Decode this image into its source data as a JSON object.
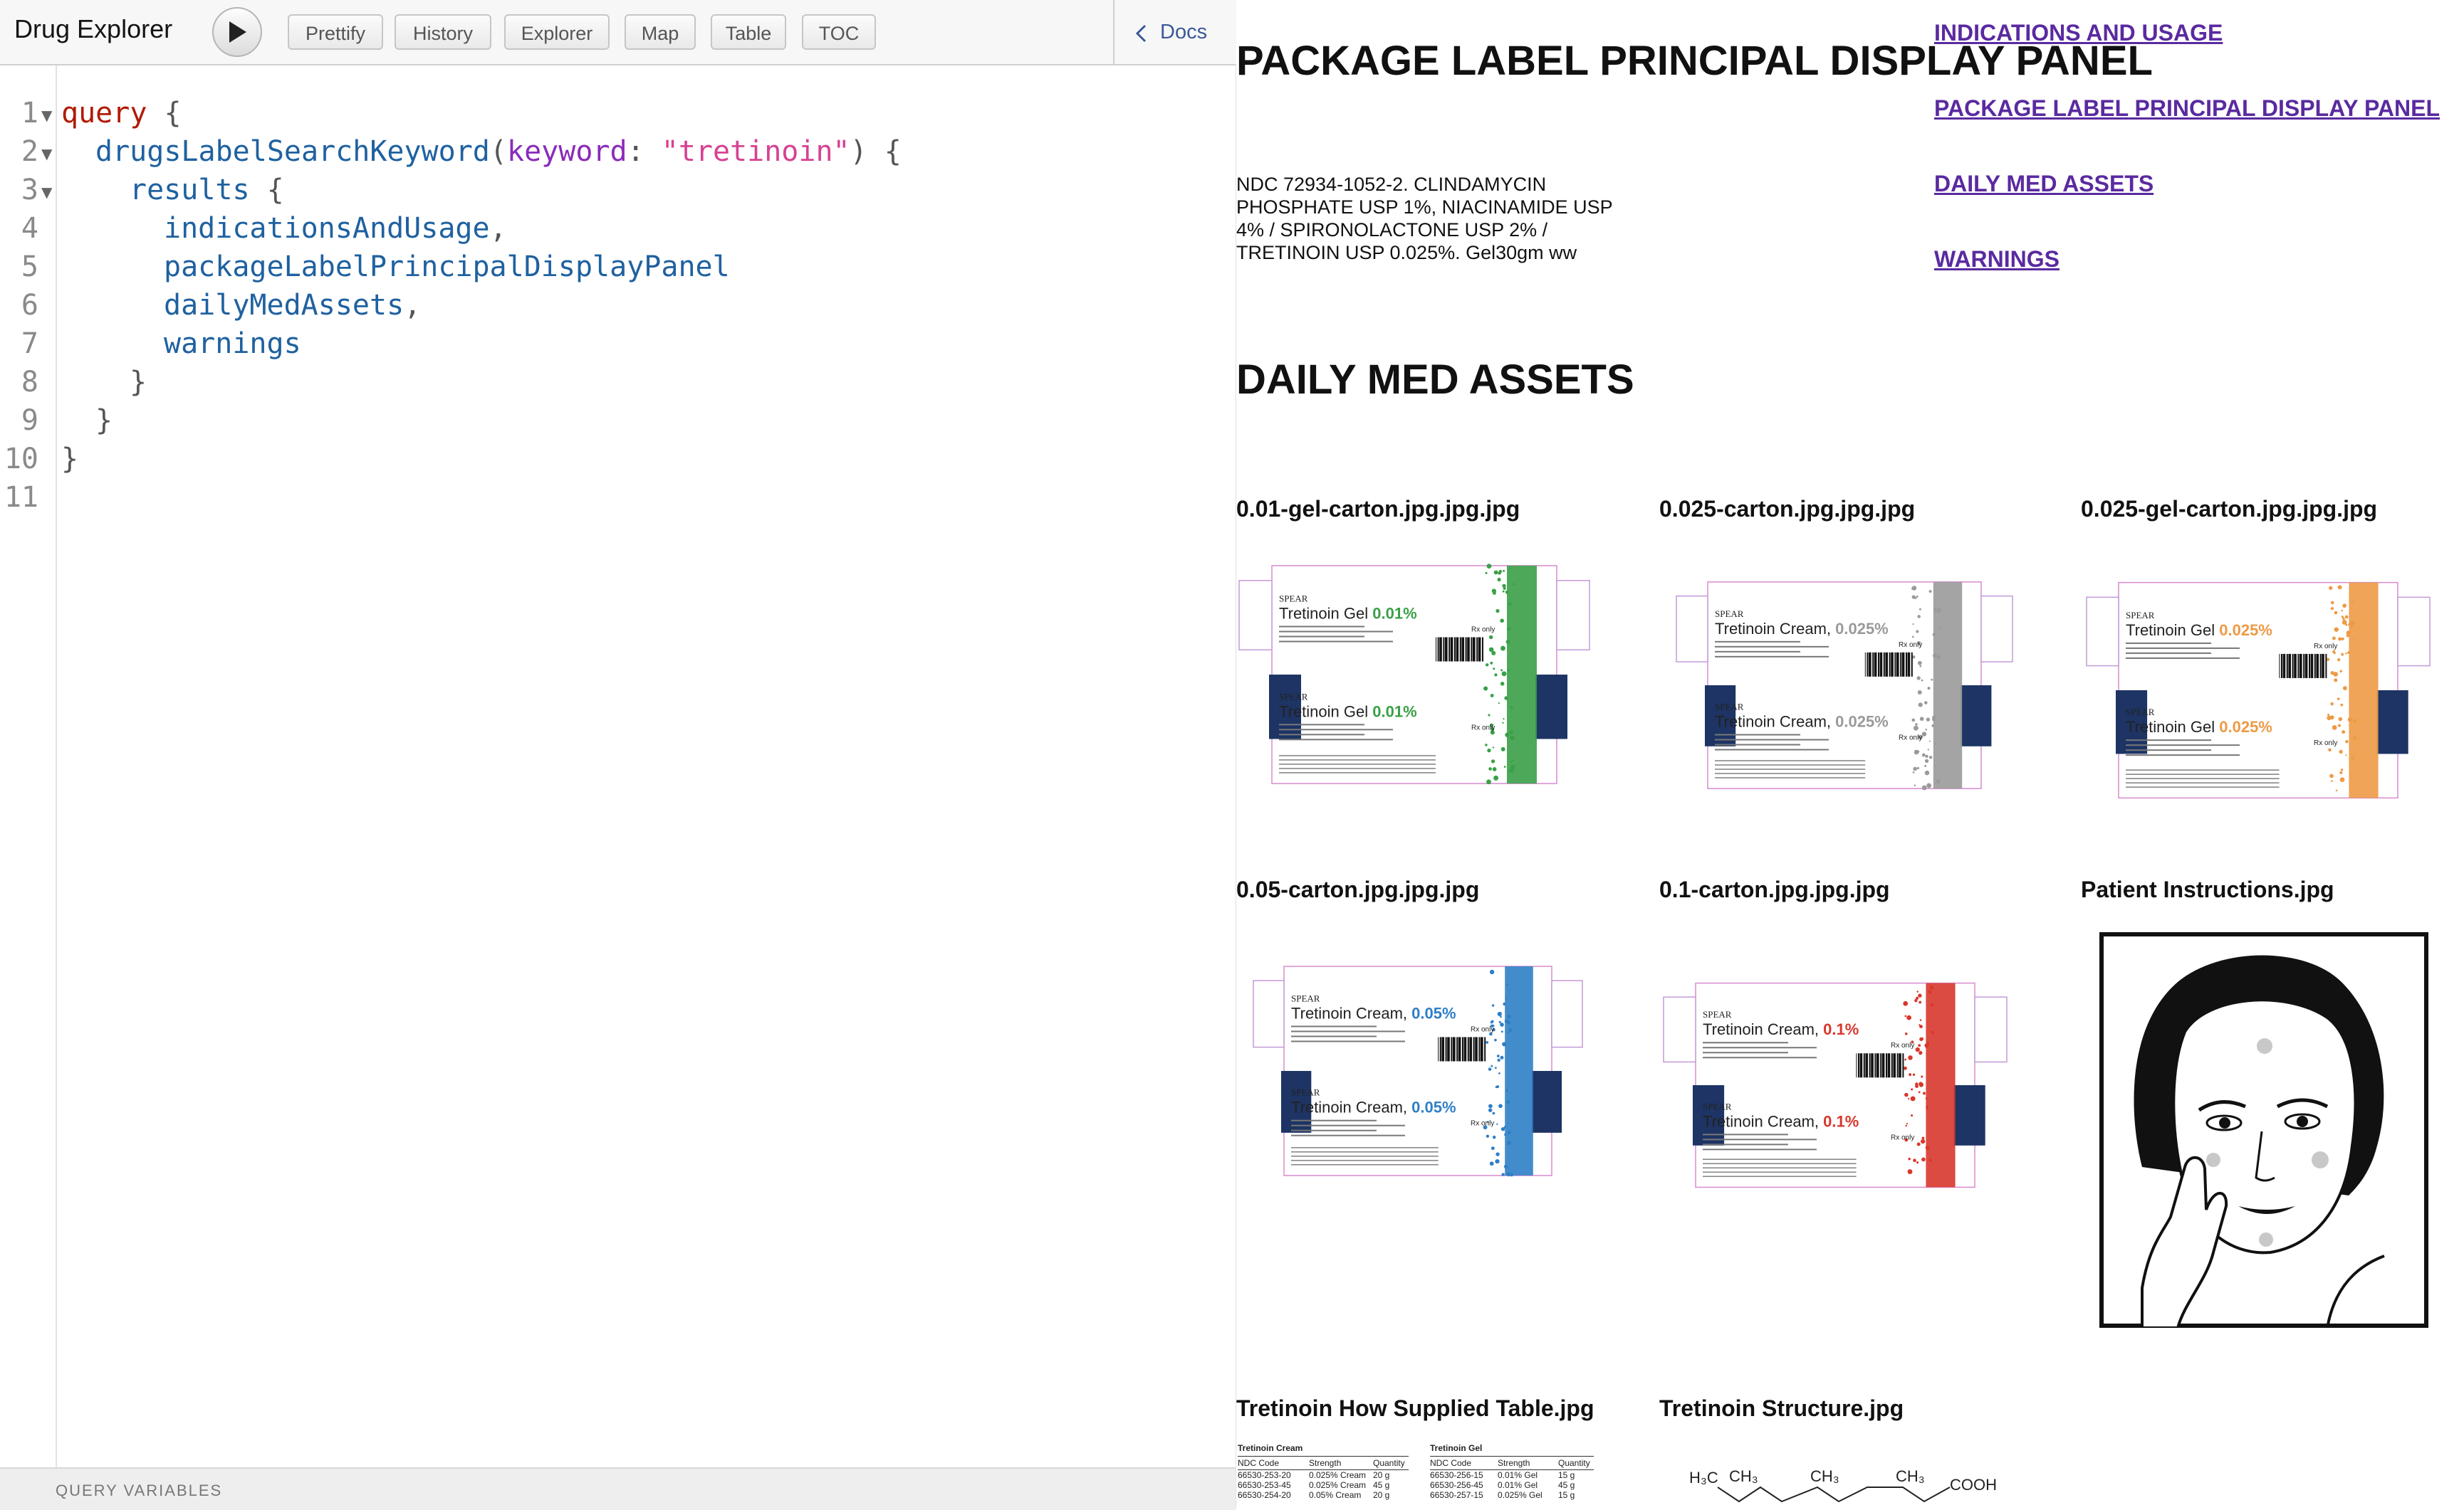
{
  "app": {
    "title": "Drug Explorer"
  },
  "toolbar": {
    "run_label": "Run",
    "buttons": [
      "Prettify",
      "History",
      "Explorer",
      "Map",
      "Table",
      "TOC"
    ],
    "docs_label": "Docs"
  },
  "editor": {
    "line_numbers": [
      "1",
      "2",
      "3",
      "4",
      "5",
      "6",
      "7",
      "8",
      "9",
      "10",
      "11"
    ],
    "lines": [
      "query {",
      "  drugsLabelSearchKeyword(keyword: \"tretinoin\") {",
      "    results {",
      "      indicationsAndUsage,",
      "      packageLabelPrincipalDisplayPanel",
      "      dailyMedAssets,",
      "      warnings",
      "    }",
      "  }",
      "}",
      ""
    ],
    "tokens": {
      "query": "query",
      "field": "drugsLabelSearchKeyword",
      "arg": "keyword",
      "string": "\"tretinoin\"",
      "results": "results",
      "f1": "indicationsAndUsage",
      "f2": "packageLabelPrincipalDisplayPanel",
      "f3": "dailyMedAssets",
      "f4": "warnings"
    }
  },
  "query_variables_label": "QUERY VARIABLES",
  "results": {
    "toc": [
      "INDICATIONS AND USAGE",
      "PACKAGE LABEL PRINCIPAL DISPLAY PANEL",
      "DAILY MED ASSETS",
      "WARNINGS"
    ],
    "package_heading": "PACKAGE LABEL PRINCIPAL DISPLAY PANEL",
    "package_text": "NDC 72934-1052-2. CLINDAMYCIN PHOSPHATE USP 1%, NIACINAMIDE USP 4% / SPIRONOLACTONE USP 2% / TRETINOIN USP 0.025%. Gel30gm ww",
    "assets_heading": "DAILY MED ASSETS",
    "assets": [
      {
        "name": "0.01-gel-carton.jpg.jpg.jpg",
        "product": "Tretinoin Gel",
        "strength": "0.01%",
        "accent": "#3aa047"
      },
      {
        "name": "0.025-carton.jpg.jpg.jpg",
        "product": "Tretinoin Cream,",
        "strength": "0.025%",
        "accent": "#9a9a9a"
      },
      {
        "name": "0.025-gel-carton.jpg.jpg.jpg",
        "product": "Tretinoin Gel",
        "strength": "0.025%",
        "accent": "#ee9a45"
      },
      {
        "name": "0.05-carton.jpg.jpg.jpg",
        "product": "Tretinoin Cream,",
        "strength": "0.05%",
        "accent": "#2f7fc6"
      },
      {
        "name": "0.1-carton.jpg.jpg.jpg",
        "product": "Tretinoin Cream,",
        "strength": "0.1%",
        "accent": "#d8372c"
      },
      {
        "name": "Patient Instructions.jpg"
      },
      {
        "name": "Tretinoin How Supplied Table.jpg"
      },
      {
        "name": "Tretinoin Structure.jpg"
      }
    ],
    "carton_brand": "SPEAR",
    "carton_rx": "Rx only",
    "supplied_table": {
      "left_title": "Tretinoin Cream",
      "right_title": "Tretinoin Gel",
      "headers": [
        "NDC Code",
        "Strength",
        "Quantity"
      ],
      "left_rows": [
        [
          "66530-253-20",
          "0.025% Cream",
          "20 g"
        ],
        [
          "66530-253-45",
          "0.025% Cream",
          "45 g"
        ],
        [
          "66530-254-20",
          "0.05% Cream",
          "20 g"
        ]
      ],
      "right_rows": [
        [
          "66530-256-15",
          "0.01% Gel",
          "15 g"
        ],
        [
          "66530-256-45",
          "0.01% Gel",
          "45 g"
        ],
        [
          "66530-257-15",
          "0.025% Gel",
          "15 g"
        ]
      ]
    },
    "structure": {
      "h3c": "H₃C",
      "ch3": "CH₃",
      "cooh": "COOH"
    }
  },
  "colors": {
    "accent_link": "#5a2aa0",
    "carton_navy": "#1d3464",
    "keyword": "#b11a04",
    "string": "#d64292"
  }
}
